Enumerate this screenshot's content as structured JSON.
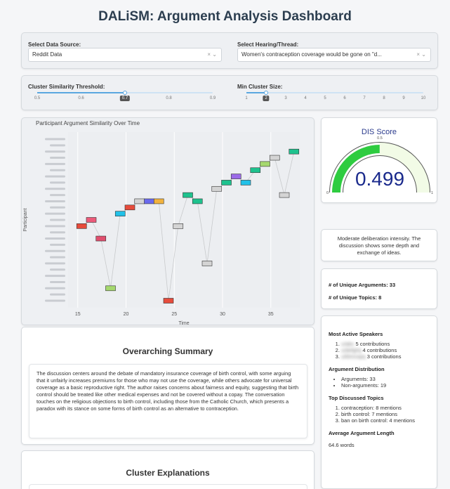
{
  "title": "DALiSM: Argument Analysis Dashboard",
  "controls": {
    "data_source_label": "Select Data Source:",
    "data_source_value": "Reddit Data",
    "thread_label": "Select Hearing/Thread:",
    "thread_value": "Women's contraception coverage would be gone on \"d...",
    "select_controls": "× ⌄",
    "threshold_label": "Cluster Similarity Threshold:",
    "threshold_ticks": [
      "0.5",
      "0.6",
      "0.7",
      "0.8",
      "0.9"
    ],
    "threshold_value": "0.7",
    "min_size_label": "Min Cluster Size:",
    "min_size_ticks": [
      "1",
      "2",
      "3",
      "4",
      "5",
      "6",
      "7",
      "8",
      "9",
      "10"
    ],
    "min_size_value": "2"
  },
  "chart_data": {
    "type": "scatter",
    "title": "Participant Argument Similarity Over Time",
    "xlabel": "Time",
    "ylabel": "Participant",
    "xlim": [
      14,
      38
    ],
    "x_ticks": [
      "15",
      "20",
      "25",
      "30",
      "35"
    ],
    "participant_count": 22,
    "points": [
      {
        "x": 15.4,
        "p": 15,
        "color": "#e74c3c"
      },
      {
        "x": 16.4,
        "p": 14,
        "color": "#ec5a7a"
      },
      {
        "x": 17.4,
        "p": 17,
        "color": "#e04e6e"
      },
      {
        "x": 18.4,
        "p": 25,
        "color": "#a5d86e"
      },
      {
        "x": 19.4,
        "p": 13,
        "color": "#22c1e8"
      },
      {
        "x": 20.4,
        "p": 12,
        "color": "#e74c3c"
      },
      {
        "x": 21.4,
        "p": 11,
        "color": "#d4d4d4"
      },
      {
        "x": 22.4,
        "p": 11,
        "color": "#6a6aee"
      },
      {
        "x": 23.4,
        "p": 11,
        "color": "#f2b23d"
      },
      {
        "x": 24.4,
        "p": 27,
        "color": "#e74c3c"
      },
      {
        "x": 25.4,
        "p": 15,
        "color": "#d4d4d4"
      },
      {
        "x": 26.4,
        "p": 10,
        "color": "#1ec28e"
      },
      {
        "x": 27.4,
        "p": 11,
        "color": "#1ec28e"
      },
      {
        "x": 28.4,
        "p": 21,
        "color": "#d4d4d4"
      },
      {
        "x": 29.4,
        "p": 9,
        "color": "#d4d4d4"
      },
      {
        "x": 30.4,
        "p": 8,
        "color": "#1ec28e"
      },
      {
        "x": 31.4,
        "p": 7,
        "color": "#9b6ae8"
      },
      {
        "x": 32.4,
        "p": 8,
        "color": "#22c1e8"
      },
      {
        "x": 33.4,
        "p": 6,
        "color": "#1ec28e"
      },
      {
        "x": 34.4,
        "p": 5,
        "color": "#a5d86e"
      },
      {
        "x": 35.4,
        "p": 4,
        "color": "#d4d4d4"
      },
      {
        "x": 36.4,
        "p": 10,
        "color": "#d4d4d4"
      },
      {
        "x": 37.4,
        "p": 3,
        "color": "#1ec28e"
      }
    ]
  },
  "dis": {
    "title": "DIS Score",
    "value": "0.499",
    "gauge_fraction": 0.499,
    "scale_min": "0",
    "scale_mid": "0.5",
    "scale_max": "1",
    "description": "Moderate deliberation intensity. The discussion shows some depth and exchange of ideas."
  },
  "stats": {
    "unique_arguments": "# of Unique Arguments: 33",
    "unique_topics": "# of Unique Topics: 8"
  },
  "sidebar": {
    "speakers_heading": "Most Active Speakers",
    "speakers": [
      {
        "name": "u/abc",
        "count": "5 contributions"
      },
      {
        "name": "u/defghij",
        "count": "4 contributions"
      },
      {
        "name": "u/klmnopq",
        "count": "3 contributions"
      }
    ],
    "distribution_heading": "Argument Distribution",
    "distribution": [
      "Arguments: 33",
      "Non-arguments: 19"
    ],
    "topics_heading": "Top Discussed Topics",
    "topics": [
      "contraception: 8 mentions",
      "birth control: 7 mentions",
      "ban on birth control: 4 mentions"
    ],
    "avg_heading": "Average Argument Length",
    "avg_value": "64.6 words"
  },
  "summary": {
    "heading": "Overarching Summary",
    "text": "The discussion centers around the debate of mandatory insurance coverage of birth control, with some arguing that it unfairly increases premiums for those who may not use the coverage, while others advocate for universal coverage as a basic reproductive right. The author raises concerns about fairness and equity, suggesting that birth control should be treated like other medical expenses and not be covered without a copay. The conversation touches on the religious objections to birth control, including those from the Catholic Church, which presents a paradox with its stance on some forms of birth control as an alternative to contraception."
  },
  "clusters": {
    "heading": "Cluster Explanations"
  }
}
